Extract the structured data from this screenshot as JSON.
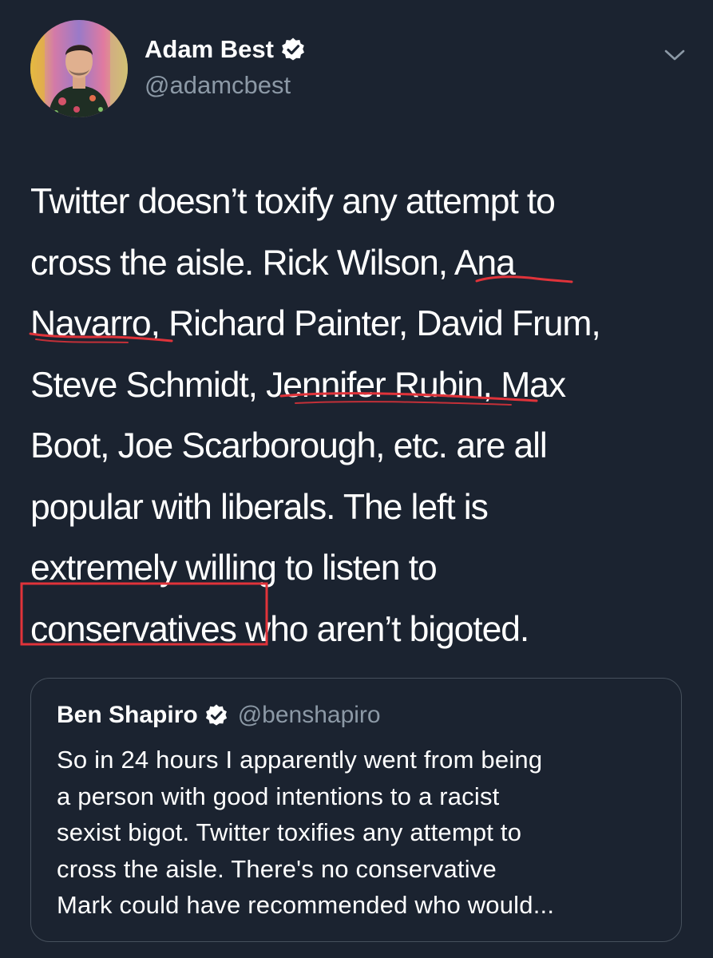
{
  "author": {
    "name": "Adam Best",
    "handle": "@adamcbest",
    "verified_icon": "verified-badge-icon"
  },
  "menu_icon": "chevron-down-icon",
  "tweet": {
    "lines": [
      "Twitter doesn’t toxify any attempt to",
      "cross the aisle. Rick Wilson, Ana",
      "Navarro, Richard Painter, David Frum,",
      "Steve Schmidt, Jennifer Rubin, Max",
      "Boot, Joe Scarborough, etc. are all",
      "popular with liberals. The left is",
      "extremely willing to listen to",
      "conservatives who aren’t bigoted."
    ]
  },
  "annotations": {
    "underline_color": "#e0333a",
    "box_color": "#e0333a"
  },
  "quoted_tweet": {
    "name": "Ben Shapiro",
    "handle": "@benshapiro",
    "lines": [
      "So in 24 hours I apparently went from being",
      "a person with good intentions to a racist",
      "sexist bigot. Twitter toxifies any attempt to",
      "cross the aisle. There's no conservative",
      "Mark could have recommended who would..."
    ]
  },
  "colors": {
    "background": "#1b2330",
    "secondary_text": "#8c99a6",
    "border": "#46505c"
  }
}
